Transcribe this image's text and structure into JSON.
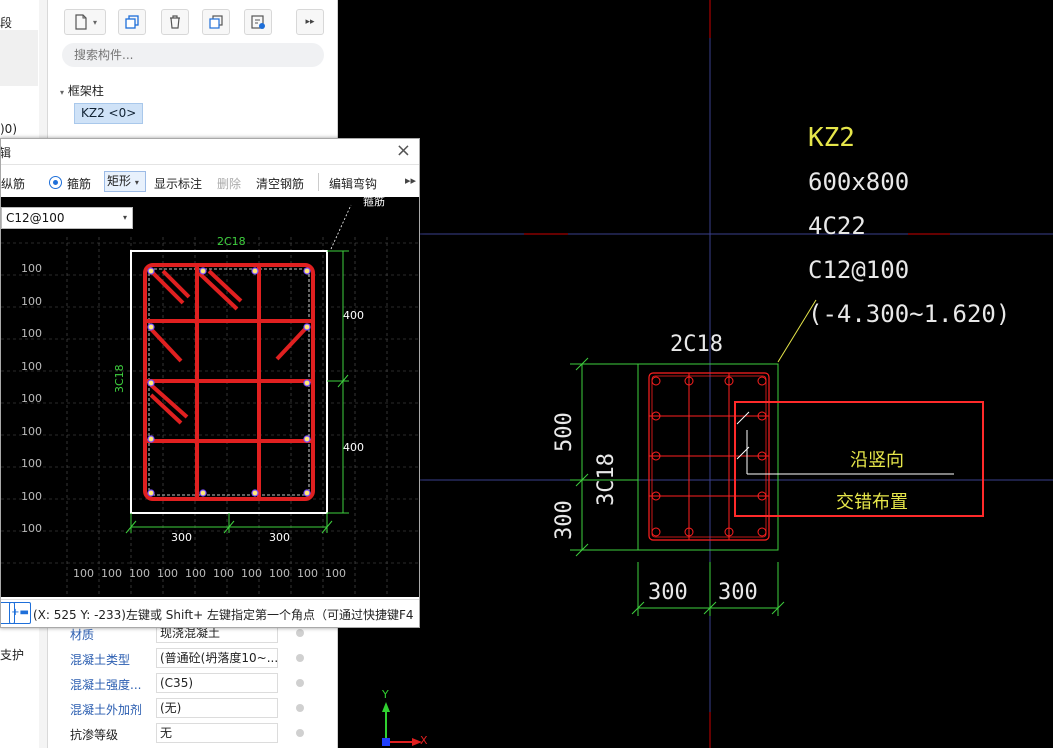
{
  "left_strip": {
    "items": [
      "段",
      ")0)",
      "支护"
    ]
  },
  "component_panel": {
    "toolbar": [
      "new-icon",
      "copy-icon",
      "delete-icon",
      "layer-copy-icon",
      "batch-icon",
      "expand-icon"
    ],
    "search_placeholder": "搜索构件...",
    "tree_parent": "框架柱",
    "tree_child": "KZ2 <0>"
  },
  "properties": [
    {
      "name": "材质",
      "value": "现浇混凝土",
      "link": true
    },
    {
      "name": "混凝土类型",
      "value": "(普通砼(坍落度10~...",
      "link": true
    },
    {
      "name": "混凝土强度...",
      "value": "(C35)",
      "link": true
    },
    {
      "name": "混凝土外加剂",
      "value": "(无)",
      "link": true
    },
    {
      "name": "抗渗等级",
      "value": "无",
      "link": false
    }
  ],
  "dialog": {
    "title": "辑",
    "close": "×",
    "toolbar": {
      "longitudinal": "纵筋",
      "stirrup": "箍筋",
      "shape": "矩形",
      "show_annotation": "显示标注",
      "delete": "删除",
      "clear_rebar": "清空钢筋",
      "edit_hook": "编辑弯钩",
      "more": "▸▸"
    },
    "spec_select": "C12@100",
    "callout_label": "箍筋",
    "section": {
      "top_label": "2C18",
      "side_label": "3C18",
      "dim_right": [
        "400",
        "400"
      ],
      "dim_bottom": [
        "300",
        "300"
      ],
      "grid_label": "100"
    },
    "status": "(X: 525 Y: -233)左键或 Shift+ 左键指定第一个角点（可通过快捷键F4"
  },
  "main_canvas": {
    "annotation": {
      "name": "KZ2",
      "size": "600x800",
      "corner": "4C22",
      "stirrup": "C12@100",
      "elevation": "(-4.300~1.620)"
    },
    "top_label": "2C18",
    "side_label": "3C18",
    "dim_left": [
      "500",
      "300"
    ],
    "dim_bottom": [
      "300",
      "300"
    ],
    "note_line1": "沿竖向",
    "note_line2": "交错布置",
    "axis_x": "X",
    "axis_y": "Y"
  }
}
